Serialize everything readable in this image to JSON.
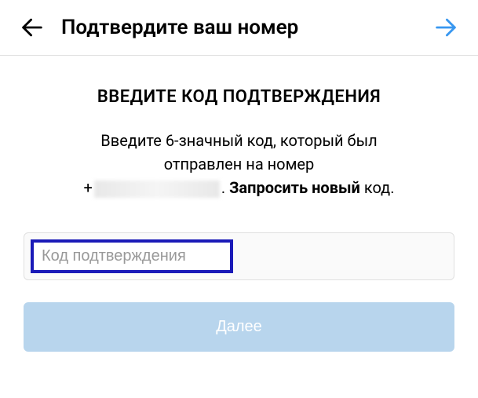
{
  "header": {
    "title": "Подтвердите ваш номер"
  },
  "content": {
    "section_title": "ВВЕДИТЕ КОД ПОДТВЕРЖДЕНИЯ",
    "instruction_line1": "Введите 6-значный код, который был",
    "instruction_line2": "отправлен на номер",
    "phone_prefix": "+",
    "period": ". ",
    "request_new": "Запросить новый",
    "request_suffix": " код.",
    "input_placeholder": "Код подтверждения",
    "next_button": "Далее"
  }
}
